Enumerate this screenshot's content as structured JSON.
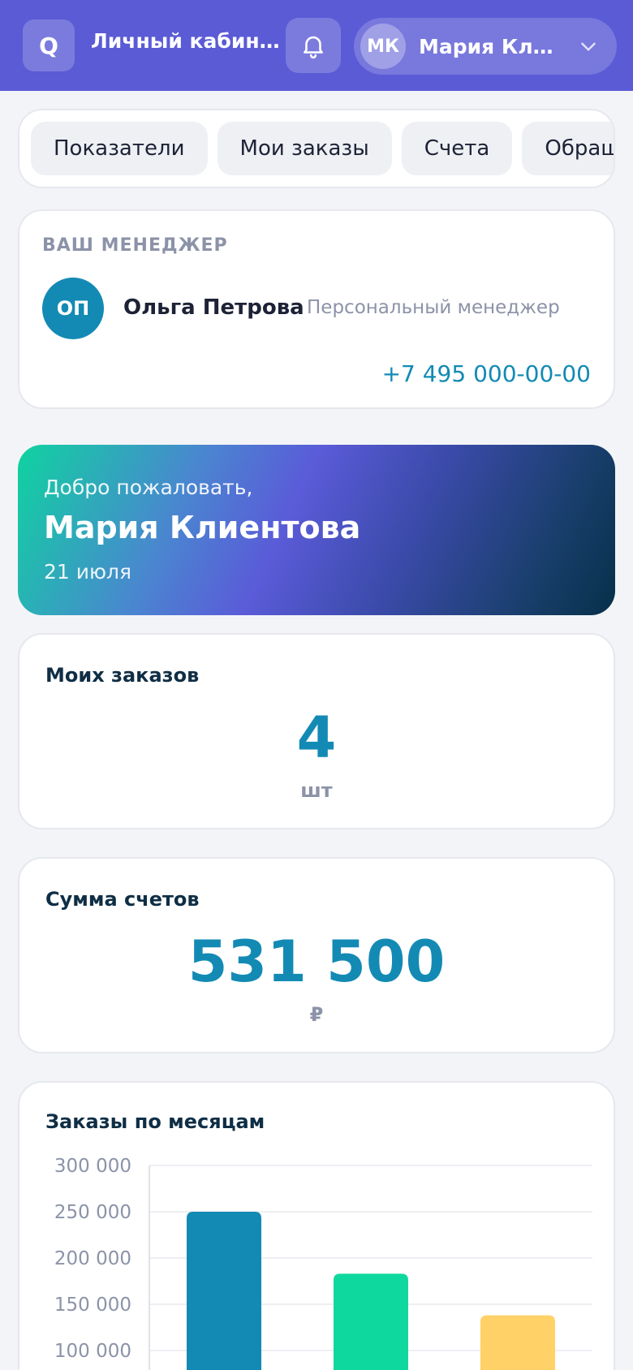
{
  "header": {
    "logo_glyph": "Q",
    "title": "Личный кабинет клиента",
    "user_initials": "МК",
    "user_name": "Мария Клиентова",
    "accent_color": "#5b5bd6"
  },
  "tabs": [
    {
      "label": "Показатели"
    },
    {
      "label": "Мои заказы"
    },
    {
      "label": "Счета"
    },
    {
      "label": "Обращения"
    }
  ],
  "manager": {
    "section_label": "ВАШ МЕНЕДЖЕР",
    "initials": "ОП",
    "name": "Ольга Петрова",
    "role": "Персональный менеджер",
    "phone": "+7 495 000-00-00"
  },
  "welcome": {
    "greeting": "Добро пожаловать,",
    "name": "Мария Клиентова",
    "date": "21 июля"
  },
  "stats": {
    "orders": {
      "title": "Моих заказов",
      "value": "4",
      "unit": "шт"
    },
    "invoices": {
      "title": "Сумма счетов",
      "value": "531 500",
      "unit": "₽"
    }
  },
  "chart": {
    "title": "Заказы по месяцам"
  },
  "chart_data": {
    "type": "bar",
    "title": "Заказы по месяцам",
    "categories": [
      "",
      "",
      ""
    ],
    "values": [
      250000,
      183000,
      138000
    ],
    "colors": [
      "#138ab4",
      "#0fd89e",
      "#ffd166"
    ],
    "y_ticks": [
      "300 000",
      "250 000",
      "200 000",
      "150 000",
      "100 000"
    ],
    "y_tick_values": [
      300000,
      250000,
      200000,
      150000,
      100000
    ],
    "ylim": [
      0,
      300000
    ],
    "grid": true
  }
}
